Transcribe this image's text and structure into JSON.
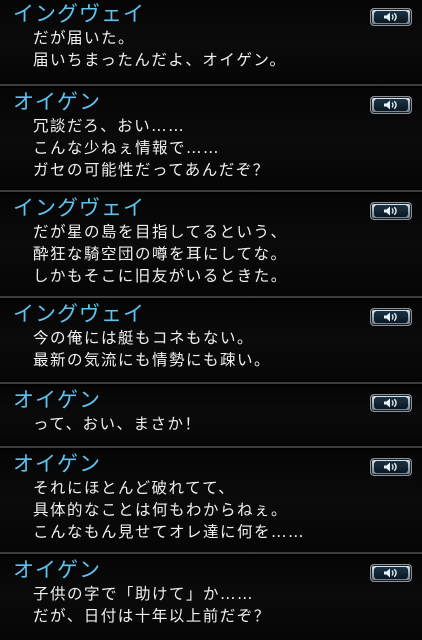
{
  "entries": [
    {
      "speaker": "イングヴェイ",
      "lines": [
        "だが届いた。",
        "届いちまったんだよ、オイゲン。"
      ],
      "voice_icon": "speaker-icon"
    },
    {
      "speaker": "オイゲン",
      "lines": [
        "冗談だろ、おい……",
        "こんな少ねぇ情報で……",
        "ガセの可能性だってあんだぞ？"
      ],
      "voice_icon": "speaker-icon"
    },
    {
      "speaker": "イングヴェイ",
      "lines": [
        "だが星の島を目指してるという、",
        "酔狂な騎空団の噂を耳にしてな。",
        "しかもそこに旧友がいるときた。"
      ],
      "voice_icon": "speaker-icon"
    },
    {
      "speaker": "イングヴェイ",
      "lines": [
        "今の俺には艇もコネもない。",
        "最新の気流にも情勢にも疎い。"
      ],
      "voice_icon": "speaker-icon"
    },
    {
      "speaker": "オイゲン",
      "lines": [
        "って、おい、まさか！"
      ],
      "voice_icon": "speaker-icon"
    },
    {
      "speaker": "オイゲン",
      "lines": [
        "それにほとんど破れてて、",
        "具体的なことは何もわからねぇ。",
        "こんなもん見せてオレ達に何を……"
      ],
      "voice_icon": "speaker-icon"
    },
    {
      "speaker": "オイゲン",
      "lines": [
        "子供の字で「助けて」か……",
        "だが、日付は十年以上前だぞ？"
      ],
      "voice_icon": "speaker-icon"
    }
  ],
  "colors": {
    "speaker": "#5fc3f0",
    "text": "#f0f0f0",
    "background": "#000000",
    "divider": "#3c3c3c"
  }
}
